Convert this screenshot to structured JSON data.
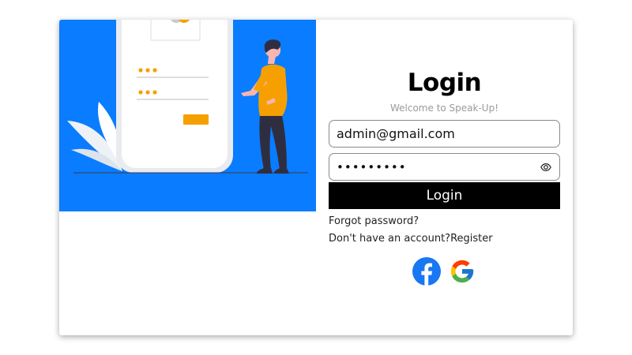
{
  "login": {
    "title": "Login",
    "subtitle": "Welcome to Speak-Up!",
    "email_value": "admin@gmail.com",
    "password_value": "•••••••••",
    "button_label": "Login",
    "forgot_password": "Forgot password?",
    "no_account_text": "Don't have an account?",
    "register_link": "Register"
  },
  "icons": {
    "password_toggle": "eye-icon",
    "facebook": "facebook-icon",
    "google": "google-icon"
  },
  "colors": {
    "illustration_bg": "#0a7cff",
    "accent_orange": "#f5a000",
    "button_bg": "#000000",
    "facebook_blue": "#1877f2"
  }
}
